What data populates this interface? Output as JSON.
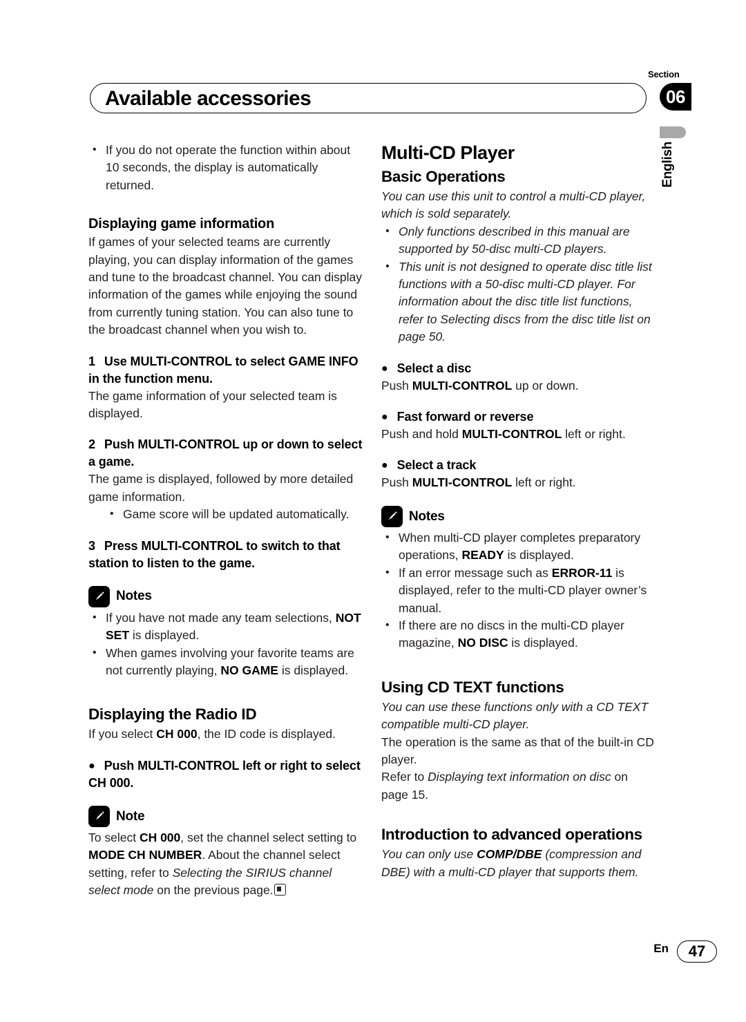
{
  "header": {
    "section_word": "Section",
    "section_number": "06",
    "title": "Available accessories",
    "language_tab": "English"
  },
  "footer": {
    "language_code": "En",
    "page_number": "47"
  },
  "icons": {
    "notes_plural": "Notes",
    "notes_singular": "Note"
  },
  "left_column": {
    "intro_bullets": [
      "If you do not operate the function within about 10 seconds, the display is automatically returned."
    ],
    "game_info": {
      "heading": "Displaying game information",
      "body": "If games of your selected teams are currently playing, you can display information of the games and tune to the broadcast channel. You can display information of the games while enjoying the sound from currently tuning station. You can also tune to the broadcast channel when you wish to.",
      "steps": [
        {
          "number": "1",
          "title": "Use MULTI-CONTROL to select GAME INFO in the function menu.",
          "body": "The game information of your selected team is displayed.",
          "sub_bullets": []
        },
        {
          "number": "2",
          "title": "Push MULTI-CONTROL up or down to select a game.",
          "body": "The game is displayed, followed by more detailed game information.",
          "sub_bullets": [
            "Game score will be updated automatically."
          ]
        },
        {
          "number": "3",
          "title": "Press MULTI-CONTROL to switch to that station to listen to the game.",
          "body": "",
          "sub_bullets": []
        }
      ],
      "notes": [
        {
          "pre": "If you have not made any team selections, ",
          "bold": "NOT SET",
          "post": " is displayed."
        },
        {
          "pre": "When games involving your favorite teams are not currently playing, ",
          "bold": "NO GAME",
          "post": " is displayed."
        }
      ]
    },
    "radio_id": {
      "heading": "Displaying the Radio ID",
      "intro_pre": "If you select ",
      "intro_bold": "CH 000",
      "intro_post": ", the ID code is displayed.",
      "action": "Push MULTI-CONTROL left or right to select CH 000.",
      "note_part1": "To select ",
      "note_bold1": "CH 000",
      "note_part2": ", set the channel select setting to ",
      "note_bold2": "MODE CH NUMBER",
      "note_part3": ". About the channel select setting, refer to ",
      "note_italic": "Selecting the SIRIUS channel select mode",
      "note_part4": " on the previous page."
    }
  },
  "right_column": {
    "multi_cd": {
      "heading": "Multi-CD Player",
      "sub_heading": "Basic Operations",
      "intro_italic": "You can use this unit to control a multi-CD player, which is sold separately.",
      "intro_bullets": [
        "Only functions described in this manual are supported by 50-disc multi-CD players.",
        "This unit is not designed to operate disc title list functions with a 50-disc multi-CD player. For information about the disc title list functions, refer to Selecting discs from the disc title list on page 50."
      ],
      "actions": [
        {
          "title": "Select a disc",
          "pre": "Push ",
          "bold": "MULTI-CONTROL",
          "post": " up or down."
        },
        {
          "title": "Fast forward or reverse",
          "pre": "Push and hold ",
          "bold": "MULTI-CONTROL",
          "post": " left or right."
        },
        {
          "title": "Select a track",
          "pre": "Push ",
          "bold": "MULTI-CONTROL",
          "post": " left or right."
        }
      ],
      "notes": [
        {
          "pre": "When multi-CD player completes preparatory operations, ",
          "bold": "READY",
          "post": " is displayed."
        },
        {
          "pre": "If an error message such as ",
          "bold": "ERROR-11",
          "post": " is displayed, refer to the multi-CD player owner’s manual."
        },
        {
          "pre": "If there are no discs in the multi-CD player magazine, ",
          "bold": "NO DISC",
          "post": " is displayed."
        }
      ]
    },
    "cd_text": {
      "heading": "Using CD TEXT functions",
      "italic_intro": "You can use these functions only with a CD TEXT compatible multi-CD player.",
      "body1": "The operation is the same as that of the built-in CD player.",
      "body2_pre": "Refer to ",
      "body2_italic": "Displaying text information on disc",
      "body2_post": " on page 15."
    },
    "advanced": {
      "heading": "Introduction to advanced operations",
      "italic_pre": "You can only use ",
      "bold": "COMP/DBE",
      "italic_post": " (compression and DBE) with a multi-CD player that supports them."
    }
  }
}
